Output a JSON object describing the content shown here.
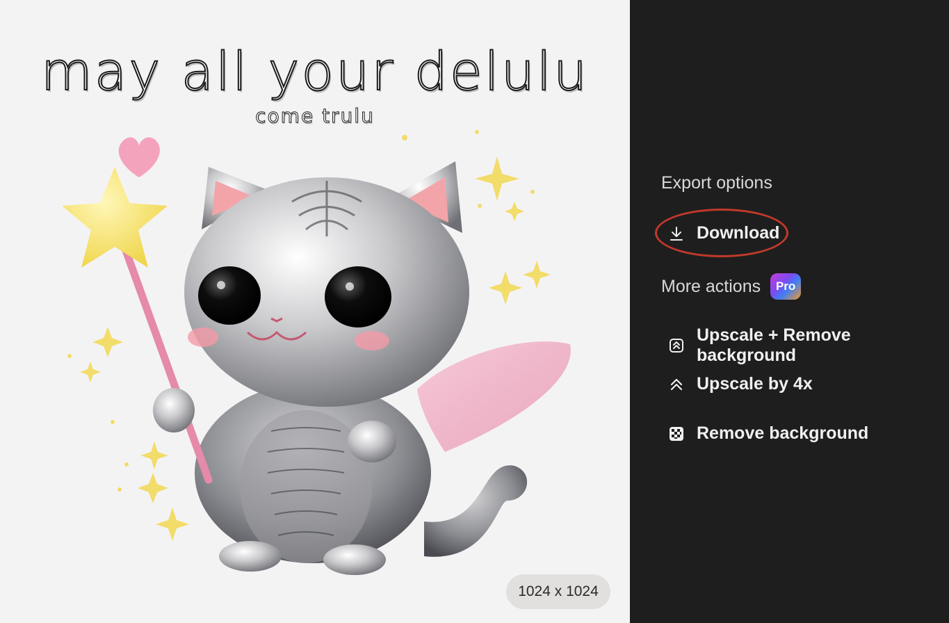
{
  "canvas": {
    "headline": "may all your delulu",
    "subline": "come trulu",
    "size_label": "1024 x 1024"
  },
  "panel": {
    "export_title": "Export options",
    "download_label": "Download",
    "more_title": "More actions",
    "pro_badge": "Pro",
    "actions": [
      {
        "label": "Upscale + Remove background",
        "icon": "upscale-remove-icon"
      },
      {
        "label": "Upscale by 4x",
        "icon": "double-chevron-up-icon"
      },
      {
        "label": "Remove background",
        "icon": "checkerboard-icon"
      }
    ]
  },
  "colors": {
    "panel_bg": "#1e1e1e",
    "canvas_bg": "#f4f3f4",
    "highlight_ring": "#c0392b"
  }
}
